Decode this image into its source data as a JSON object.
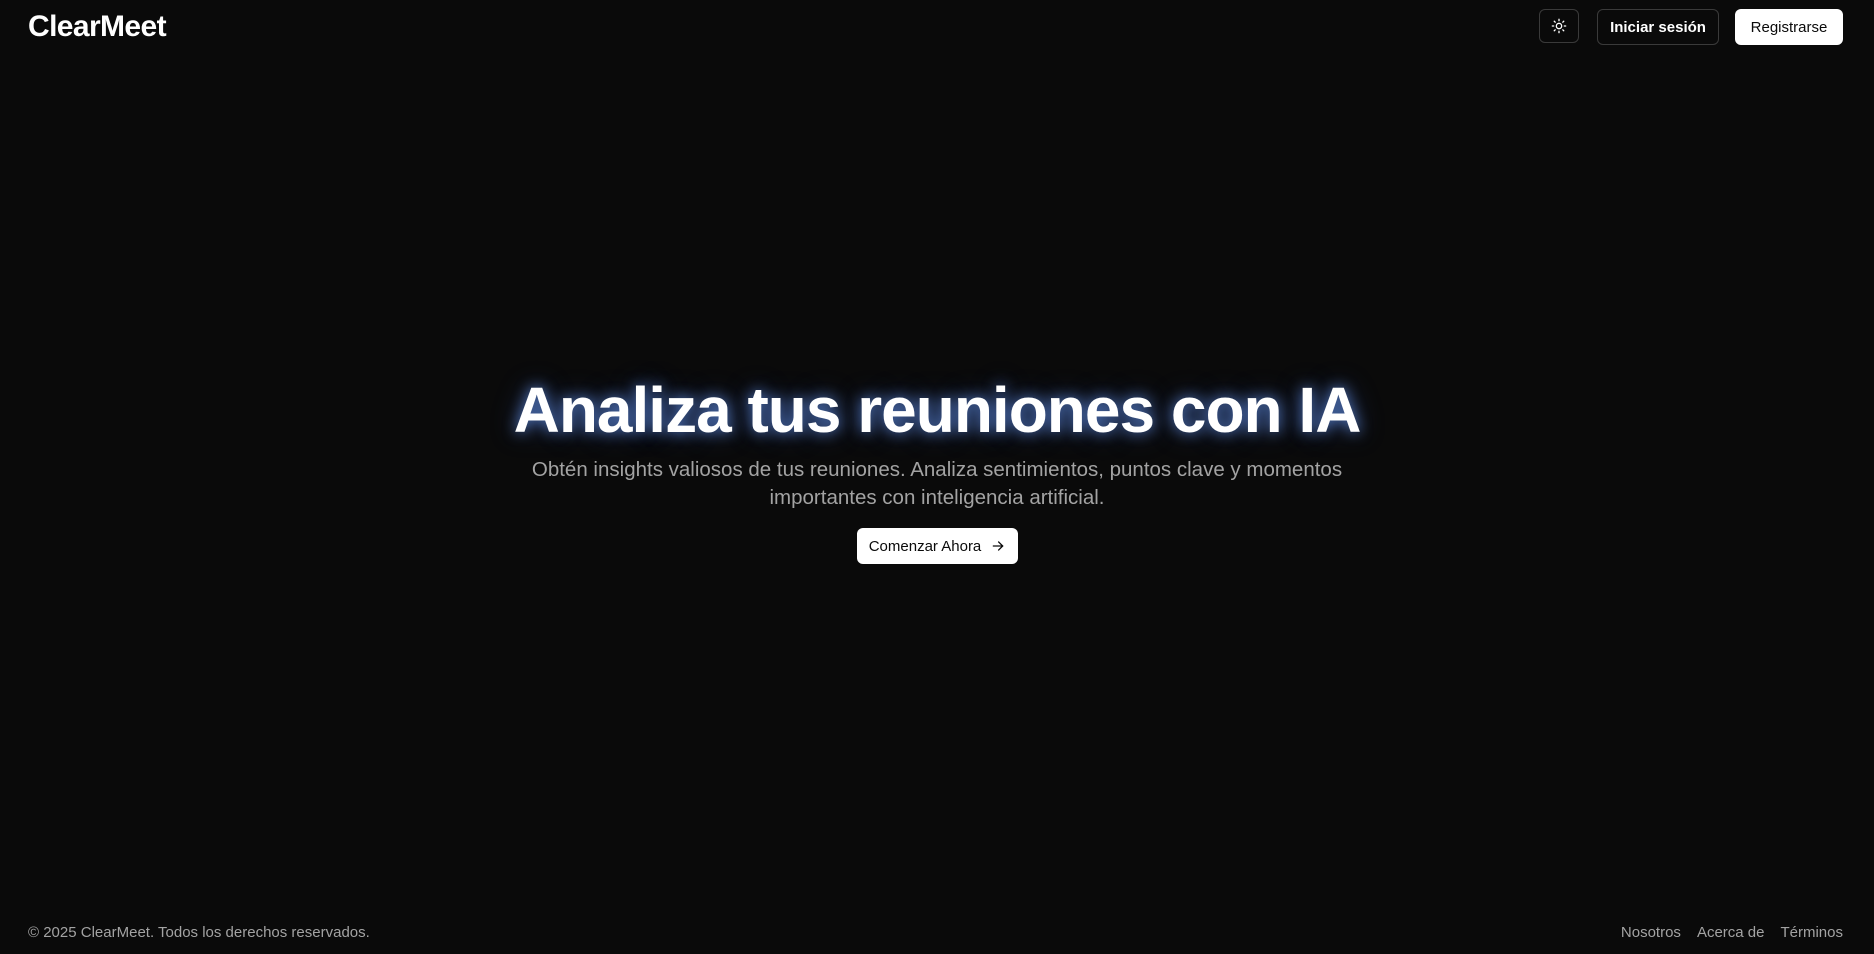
{
  "header": {
    "logo": "ClearMeet",
    "theme_toggle_icon": "sun-icon",
    "login_label": "Iniciar sesión",
    "register_label": "Registrarse"
  },
  "hero": {
    "title": "Analiza tus reuniones con IA",
    "subtitle": "Obtén insights valiosos de tus reuniones. Analiza sentimientos, puntos clave y momentos importantes con inteligencia artificial.",
    "cta_label": "Comenzar Ahora",
    "cta_icon": "arrow-right-icon"
  },
  "footer": {
    "copyright": "© 2025 ClearMeet. Todos los derechos reservados.",
    "links": [
      "Nosotros",
      "Acerca de",
      "Términos"
    ]
  },
  "colors": {
    "background": "#0a0a0a",
    "text": "#ffffff",
    "muted_text": "#a3a3a3",
    "border": "#3a3a3a",
    "title_glow": "#6ea0ff"
  }
}
